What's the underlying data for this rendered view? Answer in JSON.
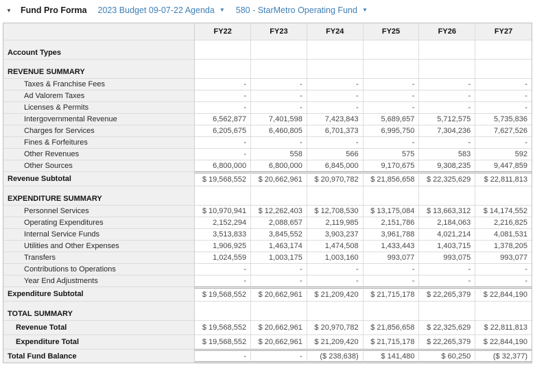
{
  "header": {
    "collapse_icon": "▼",
    "title": "Fund Pro Forma",
    "dropdown_icon": "▼",
    "dropdowns": [
      {
        "label": "2023 Budget 09-07-22 Agenda"
      },
      {
        "label": "580 - StarMetro Operating Fund"
      }
    ]
  },
  "colors": {
    "link_blue": "#3e7fb5",
    "header_row_bg": "#f0f0f0",
    "label_column_bg": "#f0f0f0",
    "grid_border": "#dcdcdc",
    "double_rule": "#a3a3a3"
  },
  "table": {
    "columns": [
      "FY22",
      "FY23",
      "FY24",
      "FY25",
      "FY26",
      "FY27"
    ],
    "rows": [
      {
        "label": "Account Types",
        "type": "section",
        "values": [
          "",
          "",
          "",
          "",
          "",
          ""
        ]
      },
      {
        "label": "REVENUE SUMMARY",
        "type": "section",
        "values": [
          "",
          "",
          "",
          "",
          "",
          ""
        ]
      },
      {
        "label": "Taxes & Franchise Fees",
        "type": "detail",
        "values": [
          "-",
          "-",
          "-",
          "-",
          "-",
          "-"
        ]
      },
      {
        "label": "Ad Valorem Taxes",
        "type": "detail",
        "values": [
          "-",
          "-",
          "-",
          "-",
          "-",
          "-"
        ]
      },
      {
        "label": "Licenses & Permits",
        "type": "detail",
        "values": [
          "-",
          "-",
          "-",
          "-",
          "-",
          "-"
        ]
      },
      {
        "label": "Intergovernmental Revenue",
        "type": "detail",
        "values": [
          "6,562,877",
          "7,401,598",
          "7,423,843",
          "5,689,657",
          "5,712,575",
          "5,735,836"
        ]
      },
      {
        "label": "Charges for Services",
        "type": "detail",
        "values": [
          "6,205,675",
          "6,460,805",
          "6,701,373",
          "6,995,750",
          "7,304,236",
          "7,627,526"
        ]
      },
      {
        "label": "Fines & Forfeitures",
        "type": "detail",
        "values": [
          "-",
          "-",
          "-",
          "-",
          "-",
          "-"
        ]
      },
      {
        "label": "Other Revenues",
        "type": "detail",
        "values": [
          "-",
          "558",
          "566",
          "575",
          "583",
          "592"
        ]
      },
      {
        "label": "Other Sources",
        "type": "detail",
        "values": [
          "6,800,000",
          "6,800,000",
          "6,845,000",
          "9,170,675",
          "9,308,235",
          "9,447,859"
        ]
      },
      {
        "label": "Revenue Subtotal",
        "type": "subtotal",
        "values": [
          "$ 19,568,552",
          "$ 20,662,961",
          "$ 20,970,782",
          "$ 21,856,658",
          "$ 22,325,629",
          "$ 22,811,813"
        ]
      },
      {
        "label": "EXPENDITURE SUMMARY",
        "type": "section",
        "values": [
          "",
          "",
          "",
          "",
          "",
          ""
        ]
      },
      {
        "label": "Personnel Services",
        "type": "detail",
        "values": [
          "$ 10,970,941",
          "$ 12,262,403",
          "$ 12,708,530",
          "$ 13,175,084",
          "$ 13,663,312",
          "$ 14,174,552"
        ]
      },
      {
        "label": "Operating Expenditures",
        "type": "detail",
        "values": [
          "2,152,294",
          "2,088,657",
          "2,119,985",
          "2,151,786",
          "2,184,063",
          "2,216,825"
        ]
      },
      {
        "label": "Internal Service Funds",
        "type": "detail",
        "values": [
          "3,513,833",
          "3,845,552",
          "3,903,237",
          "3,961,788",
          "4,021,214",
          "4,081,531"
        ]
      },
      {
        "label": "Utilities and Other Expenses",
        "type": "detail",
        "values": [
          "1,906,925",
          "1,463,174",
          "1,474,508",
          "1,433,443",
          "1,403,715",
          "1,378,205"
        ]
      },
      {
        "label": "Transfers",
        "type": "detail",
        "values": [
          "1,024,559",
          "1,003,175",
          "1,003,160",
          "993,077",
          "993,075",
          "993,077"
        ]
      },
      {
        "label": "Contributions to Operations",
        "type": "detail",
        "values": [
          "-",
          "-",
          "-",
          "-",
          "-",
          "-"
        ]
      },
      {
        "label": "Year End Adjustments",
        "type": "detail",
        "values": [
          "-",
          "-",
          "-",
          "-",
          "-",
          "-"
        ]
      },
      {
        "label": "Expenditure Subtotal",
        "type": "subtotal",
        "values": [
          "$ 19,568,552",
          "$ 20,662,961",
          "$ 21,209,420",
          "$ 21,715,178",
          "$ 22,265,379",
          "$ 22,844,190"
        ]
      },
      {
        "label": "TOTAL SUMMARY",
        "type": "section",
        "values": [
          "",
          "",
          "",
          "",
          "",
          ""
        ]
      },
      {
        "label": "Revenue Total",
        "type": "total",
        "values": [
          "$ 19,568,552",
          "$ 20,662,961",
          "$ 20,970,782",
          "$ 21,856,658",
          "$ 22,325,629",
          "$ 22,811,813"
        ]
      },
      {
        "label": "Expenditure Total",
        "type": "total",
        "values": [
          "$ 19,568,552",
          "$ 20,662,961",
          "$ 21,209,420",
          "$ 21,715,178",
          "$ 22,265,379",
          "$ 22,844,190"
        ]
      },
      {
        "label": "Total Fund Balance",
        "type": "grand",
        "values": [
          "-",
          "-",
          "($ 238,638)",
          "$ 141,480",
          "$ 60,250",
          "($ 32,377)"
        ]
      }
    ]
  }
}
